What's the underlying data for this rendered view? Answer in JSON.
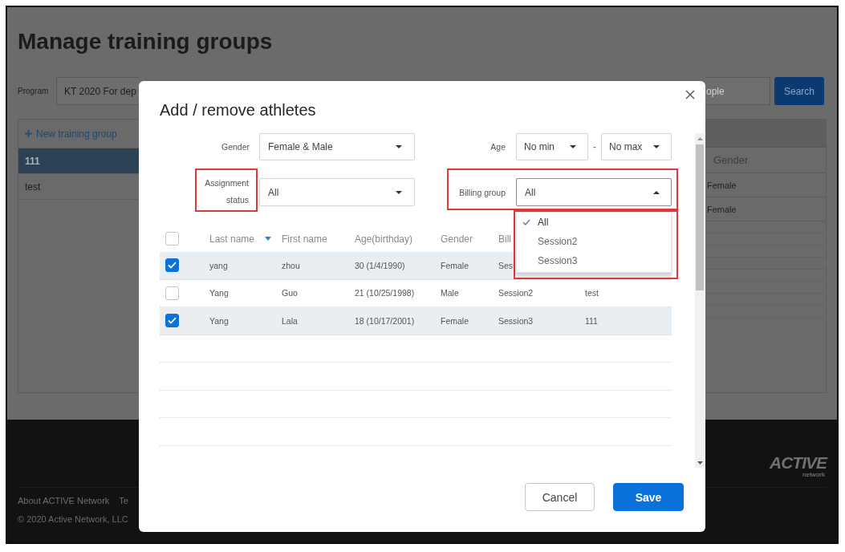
{
  "page": {
    "title": "Manage training groups",
    "program": {
      "label": "Program",
      "value": "KT 2020 For dep"
    },
    "search": {
      "placeholder": "ople",
      "button": "Search"
    },
    "groups": {
      "new_button": "New training group",
      "items": [
        {
          "name": "111",
          "selected": true
        },
        {
          "name": "test",
          "selected": false
        }
      ]
    },
    "members": {
      "columns": [
        "Gender"
      ],
      "rows": [
        [
          "Female"
        ],
        [
          "Female"
        ]
      ]
    },
    "footer": {
      "links": [
        "About ACTIVE Network",
        "Te"
      ],
      "copyright": "© 2020 Active Network, LLC",
      "logo": {
        "name": "ACTIVE",
        "tagline": "network"
      }
    }
  },
  "dialog": {
    "title": "Add / remove athletes",
    "filters": {
      "gender": {
        "label": "Gender",
        "value": "Female & Male"
      },
      "age": {
        "label": "Age",
        "min": "No min",
        "separator": "-",
        "max": "No max"
      },
      "assignment_status": {
        "label": "Assignment status",
        "value": "All",
        "highlighted": true
      },
      "billing_group": {
        "label": "Billing group",
        "value": "All",
        "highlighted": true,
        "expanded": true,
        "options": [
          {
            "label": "All",
            "selected": true
          },
          {
            "label": "Session2",
            "selected": false
          },
          {
            "label": "Session3",
            "selected": false
          }
        ]
      }
    },
    "table": {
      "all_checked": false,
      "columns": [
        {
          "label": "Last name",
          "sorted": true
        },
        {
          "label": "First name",
          "sorted": false
        },
        {
          "label": "Age(birthday)",
          "sorted": false
        },
        {
          "label": "Gender",
          "sorted": false
        },
        {
          "label": "Bill",
          "sorted": false
        }
      ],
      "rows": [
        {
          "checked": true,
          "cells": [
            "yang",
            "zhou",
            "30 (1/4/1990)",
            "Female",
            "Ses"
          ]
        },
        {
          "checked": false,
          "cells": [
            "Yang",
            "Guo",
            "21 (10/25/1998)",
            "Male",
            "Session2",
            "test"
          ]
        },
        {
          "checked": true,
          "cells": [
            "Yang",
            "Lala",
            "18 (10/17/2001)",
            "Female",
            "Session3",
            "111"
          ]
        }
      ]
    },
    "buttons": [
      {
        "label": "Cancel",
        "kind": "secondary"
      },
      {
        "label": "Save",
        "kind": "primary"
      }
    ]
  }
}
